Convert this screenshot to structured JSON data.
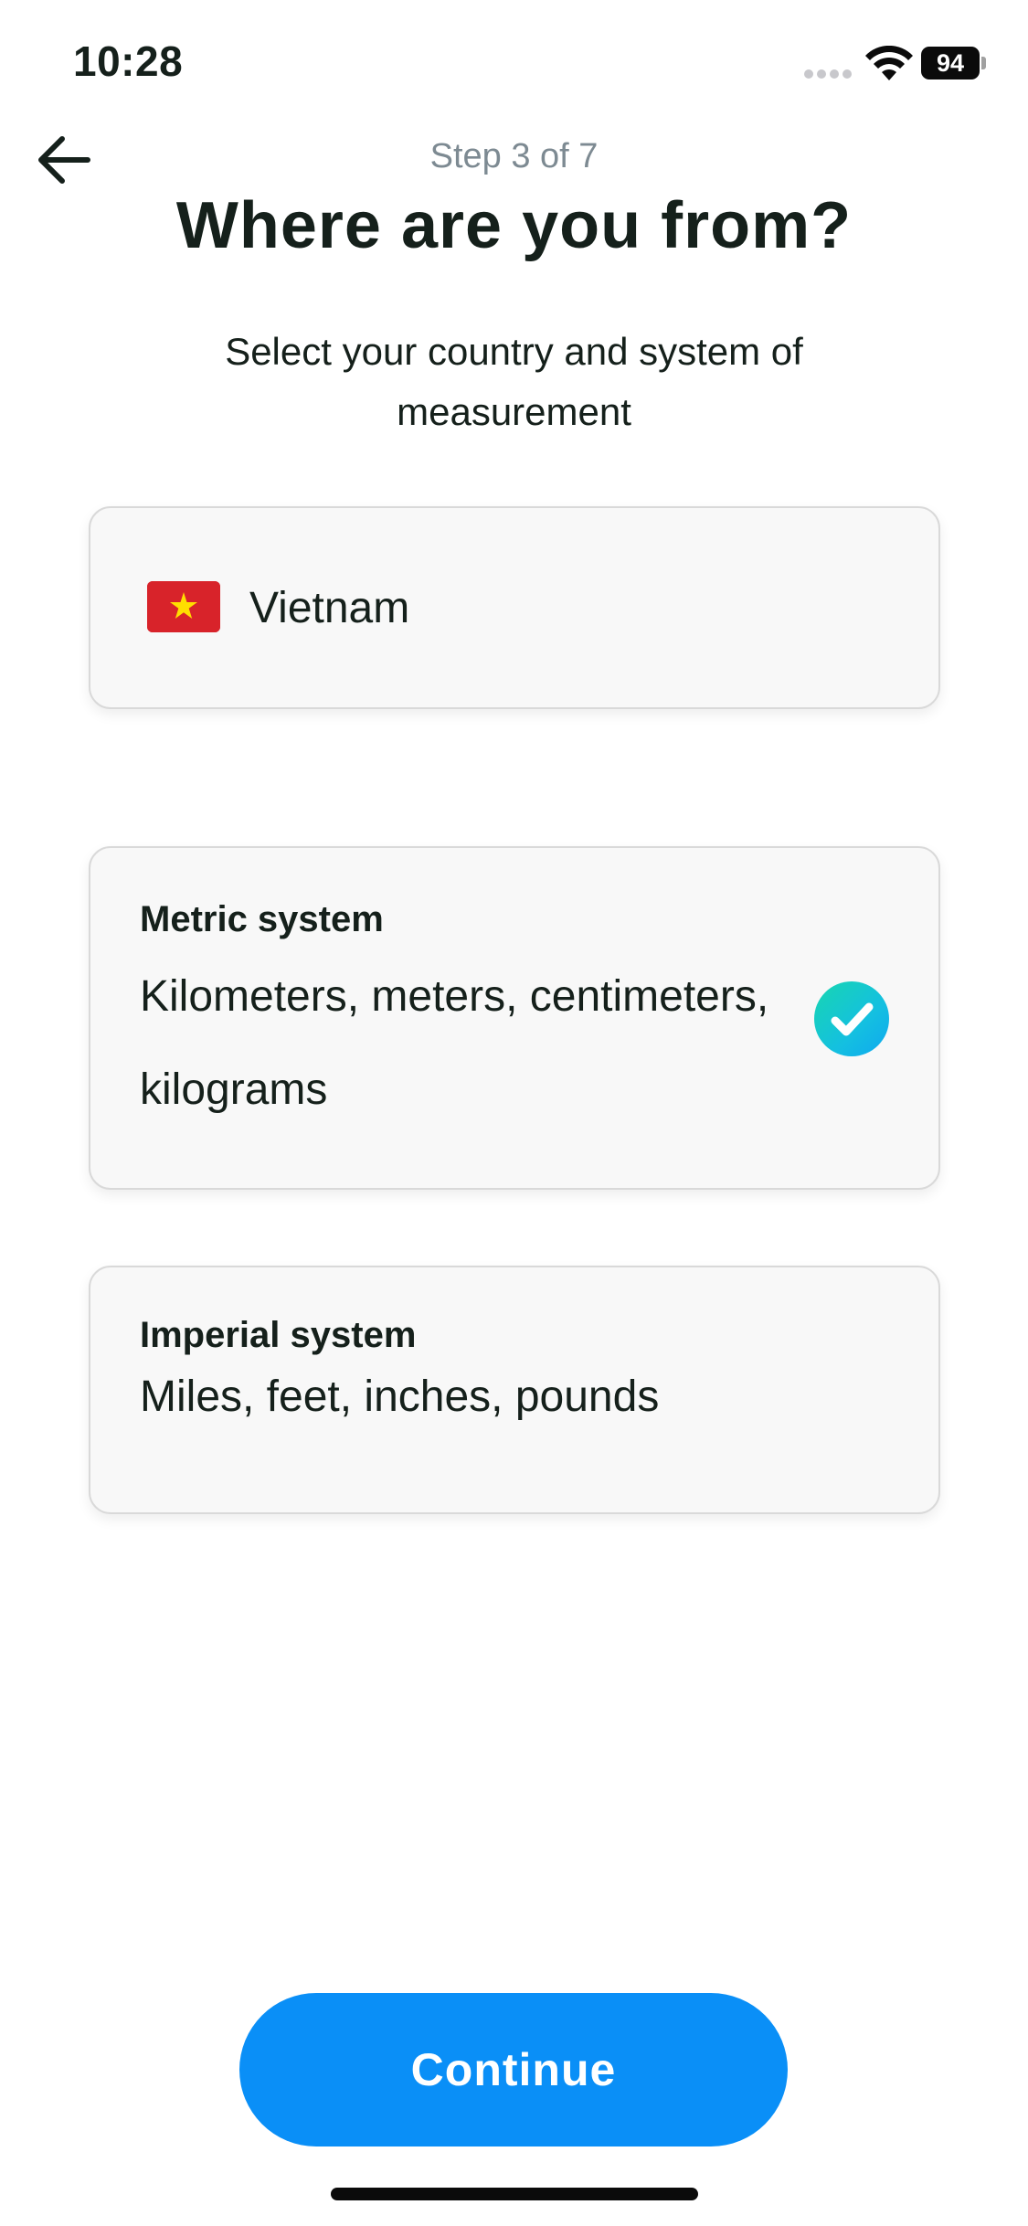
{
  "status_bar": {
    "time": "10:28",
    "battery": "94"
  },
  "header": {
    "step": "Step 3 of 7",
    "title": "Where are you from?",
    "subtitle": "Select your country and system of measurement"
  },
  "country": {
    "name": "Vietnam",
    "flag_icon": "vietnam-flag-icon"
  },
  "options": [
    {
      "title": "Metric system",
      "description": "Kilometers, meters, centimeters, kilograms",
      "selected": true
    },
    {
      "title": "Imperial system",
      "description": "Miles, feet, inches, pounds",
      "selected": false
    }
  ],
  "continue_label": "Continue",
  "colors": {
    "accent": "#0a8ff7",
    "check_start": "#18d6b0",
    "check_end": "#0fa8f0",
    "flag_red": "#d8232a",
    "flag_star": "#ffde00"
  }
}
